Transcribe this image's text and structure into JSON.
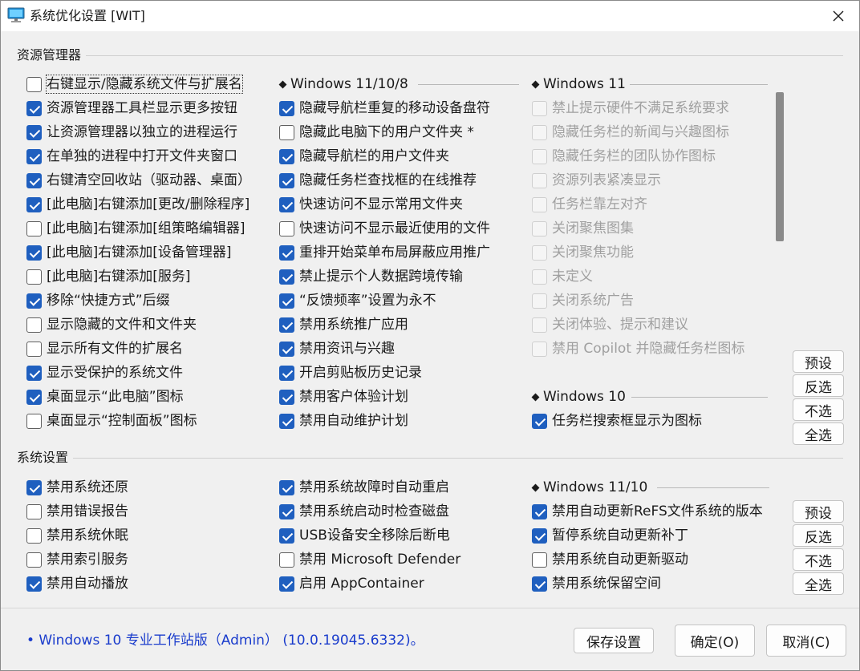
{
  "window": {
    "title": "系统优化设置 [WIT]"
  },
  "explorer": {
    "label": "资源管理器",
    "col1": [
      {
        "label": "右键显示/隐藏系统文件与扩展名",
        "checked": false,
        "focused": true
      },
      {
        "label": "资源管理器工具栏显示更多按钮",
        "checked": true
      },
      {
        "label": "让资源管理器以独立的进程运行",
        "checked": true
      },
      {
        "label": "在单独的进程中打开文件夹窗口",
        "checked": true
      },
      {
        "label": "右键清空回收站（驱动器、桌面）",
        "checked": true
      },
      {
        "label": "[此电脑]右键添加[更改/删除程序]",
        "checked": true
      },
      {
        "label": "[此电脑]右键添加[组策略编辑器]",
        "checked": false
      },
      {
        "label": "[此电脑]右键添加[设备管理器]",
        "checked": true
      },
      {
        "label": "[此电脑]右键添加[服务]",
        "checked": false
      },
      {
        "label": "移除“快捷方式”后缀",
        "checked": true
      },
      {
        "label": "显示隐藏的文件和文件夹",
        "checked": false
      },
      {
        "label": "显示所有文件的扩展名",
        "checked": false
      },
      {
        "label": "显示受保护的系统文件",
        "checked": true
      },
      {
        "label": "桌面显示“此电脑”图标",
        "checked": true
      },
      {
        "label": "桌面显示“控制面板”图标",
        "checked": false
      }
    ],
    "col2_heading": "Windows 11/10/8",
    "col2": [
      {
        "label": "隐藏导航栏重复的移动设备盘符",
        "checked": true
      },
      {
        "label": "隐藏此电脑下的用户文件夹 *",
        "checked": false
      },
      {
        "label": "隐藏导航栏的用户文件夹",
        "checked": true
      },
      {
        "label": "隐藏任务栏查找框的在线推荐",
        "checked": true
      },
      {
        "label": "快速访问不显示常用文件夹",
        "checked": true
      },
      {
        "label": "快速访问不显示最近使用的文件",
        "checked": false
      },
      {
        "label": "重排开始菜单布局屏蔽应用推广",
        "checked": true
      },
      {
        "label": "禁止提示个人数据跨境传输",
        "checked": true
      },
      {
        "label": "“反馈频率”设置为永不",
        "checked": true
      },
      {
        "label": "禁用系统推广应用",
        "checked": true
      },
      {
        "label": "禁用资讯与兴趣",
        "checked": true
      },
      {
        "label": "开启剪贴板历史记录",
        "checked": true
      },
      {
        "label": "禁用客户体验计划",
        "checked": true
      },
      {
        "label": "禁用自动维护计划",
        "checked": true
      }
    ],
    "col3_heading": "Windows 11",
    "col3": [
      {
        "label": "禁止提示硬件不满足系统要求",
        "checked": false
      },
      {
        "label": "隐藏任务栏的新闻与兴趣图标",
        "checked": false
      },
      {
        "label": "隐藏任务栏的团队协作图标",
        "checked": false
      },
      {
        "label": "资源列表紧凑显示",
        "checked": false
      },
      {
        "label": "任务栏靠左对齐",
        "checked": false
      },
      {
        "label": "关闭聚焦图集",
        "checked": false
      },
      {
        "label": "关闭聚焦功能",
        "checked": false
      },
      {
        "label": "未定义",
        "checked": false
      },
      {
        "label": "关闭系统广告",
        "checked": false
      },
      {
        "label": "关闭体验、提示和建议",
        "checked": false
      },
      {
        "label": "禁用 Copilot 并隐藏任务栏图标",
        "checked": false
      }
    ],
    "col3b_heading": "Windows 10",
    "col3b": [
      {
        "label": "任务栏搜索框显示为图标",
        "checked": true
      }
    ],
    "buttons": {
      "preset": "预设",
      "invert": "反选",
      "none": "不选",
      "all": "全选"
    }
  },
  "system": {
    "label": "系统设置",
    "col1": [
      {
        "label": "禁用系统还原",
        "checked": true
      },
      {
        "label": "禁用错误报告",
        "checked": false
      },
      {
        "label": "禁用系统休眠",
        "checked": false
      },
      {
        "label": "禁用索引服务",
        "checked": false
      },
      {
        "label": "禁用自动播放",
        "checked": true
      }
    ],
    "col2": [
      {
        "label": "禁用系统故障时自动重启",
        "checked": true
      },
      {
        "label": "禁用系统启动时检查磁盘",
        "checked": true
      },
      {
        "label": "USB设备安全移除后断电",
        "checked": true
      },
      {
        "label": "禁用 Microsoft Defender",
        "checked": false
      },
      {
        "label": "启用 AppContainer",
        "checked": true
      }
    ],
    "col3_heading": "Windows 11/10",
    "col3": [
      {
        "label": "禁用自动更新ReFS文件系统的版本",
        "checked": true
      },
      {
        "label": "暂停系统自动更新补丁",
        "checked": true
      },
      {
        "label": "禁用系统自动更新驱动",
        "checked": false
      },
      {
        "label": "禁用系统保留空间",
        "checked": true
      }
    ],
    "buttons": {
      "preset": "预设",
      "invert": "反选",
      "none": "不选",
      "all": "全选"
    }
  },
  "footer": {
    "status": "• Windows 10 专业工作站版（Admin） (10.0.19045.6332)。",
    "save": "保存设置",
    "ok": "确定(O)",
    "cancel": "取消(C)"
  }
}
